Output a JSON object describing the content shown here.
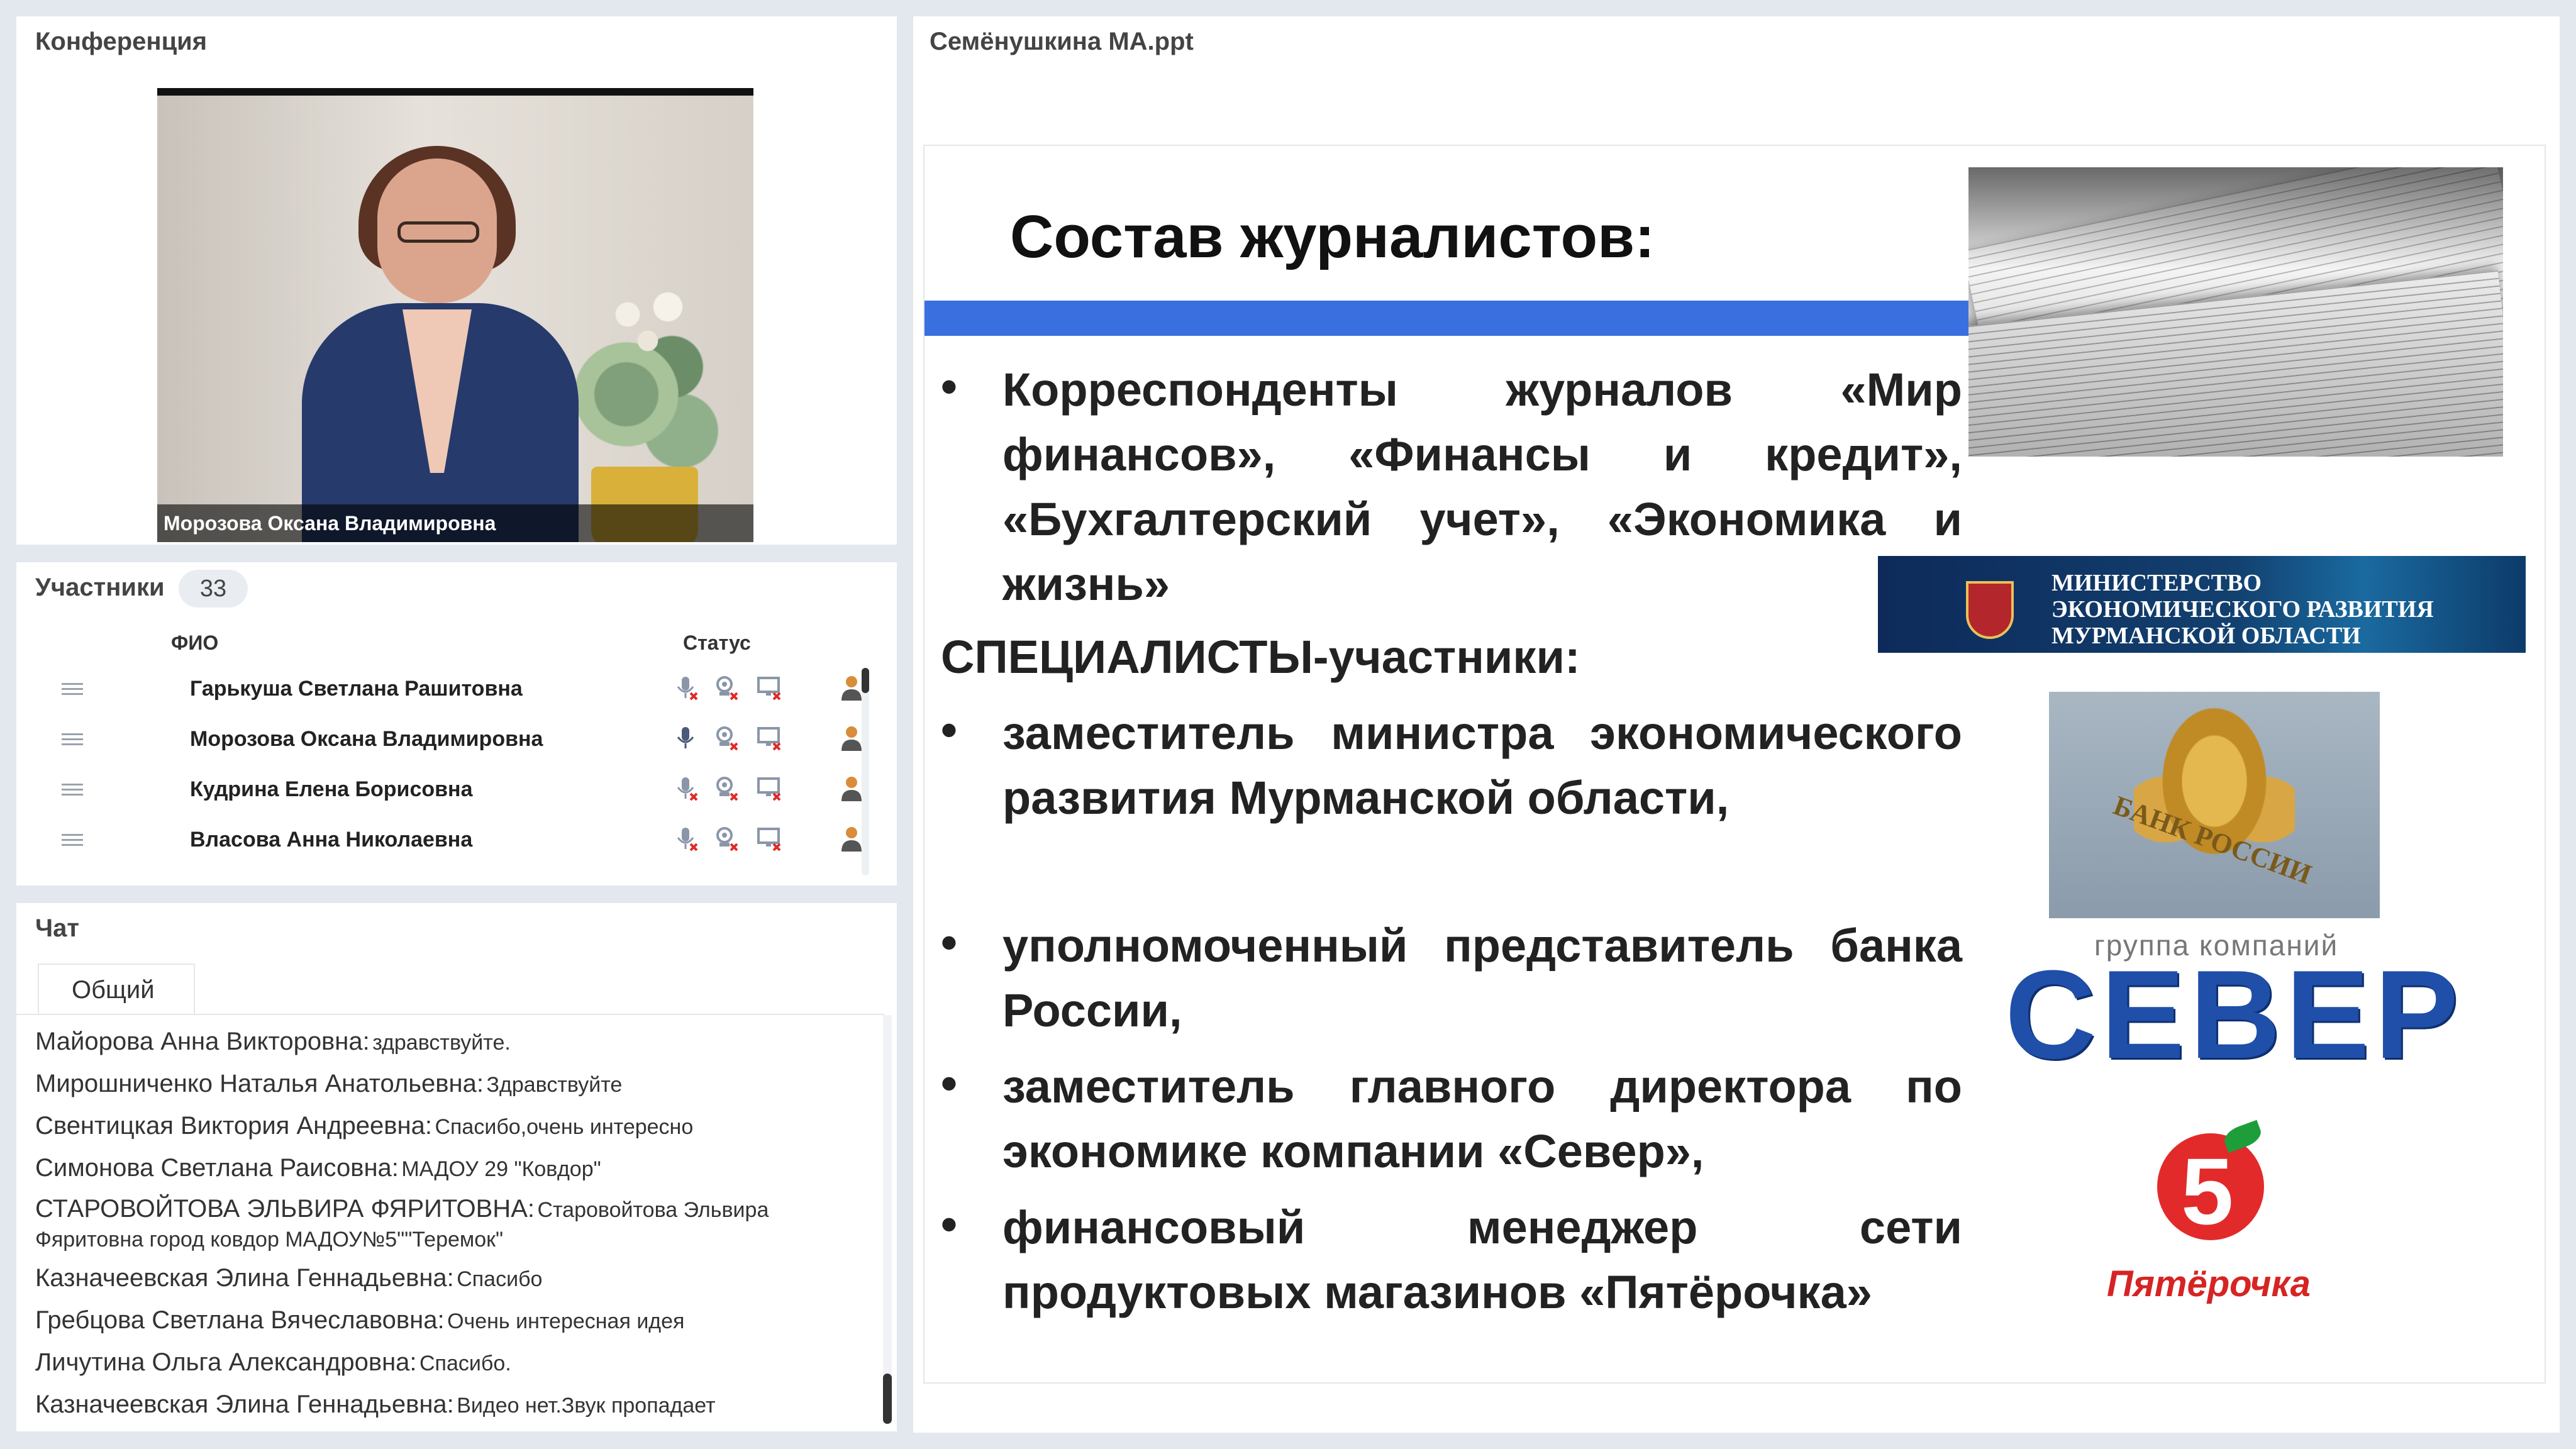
{
  "conference": {
    "title": "Конференция",
    "speaker_name": "Морозова Оксана Владимировна"
  },
  "participants": {
    "title": "Участники",
    "count": "33",
    "col_name": "ФИО",
    "col_status": "Статус",
    "rows": [
      {
        "name": "Гарькуша Светлана Рашитовна",
        "mic": "muted"
      },
      {
        "name": "Морозова Оксана Владимировна",
        "mic": "active"
      },
      {
        "name": "Кудрина Елена Борисовна",
        "mic": "muted"
      },
      {
        "name": "Власова Анна Николаевна",
        "mic": "muted"
      }
    ]
  },
  "chat": {
    "title": "Чат",
    "tab": "Общий",
    "messages": [
      {
        "author": "Майорова Анна Викторовна:",
        "text": "здравствуйте."
      },
      {
        "author": "Мирошниченко Наталья Анатольевна:",
        "text": "Здравствуйте"
      },
      {
        "author": "Свентицкая Виктория Андреевна:",
        "text": "Спасибо,очень интересно"
      },
      {
        "author": "Симонова  Светлана Раисовна:",
        "text": "МАДОУ 29 \"Ковдор\""
      },
      {
        "author": "СТАРОВОЙТОВА ЭЛЬВИРА ФЯРИТОВНА:",
        "text": "Старовойтова Эльвира Фяритовна город ковдор МАДОУ№5\"\"Теремок\""
      },
      {
        "author": "Казначеевская Элина Геннадьевна:",
        "text": "Спасибо"
      },
      {
        "author": "Гребцова Светлана Вячеславовна:",
        "text": "Очень интересная идея"
      },
      {
        "author": "Личутина  Ольга Александровна:",
        "text": "Спасибо."
      },
      {
        "author": "Казначеевская Элина Геннадьевна:",
        "text": "Видео нет.Звук  пропадает"
      }
    ]
  },
  "presentation": {
    "file_title": "Семёнушкина МА.ppt",
    "slide": {
      "title": "Состав журналистов:",
      "bullet1": "Корреспонденты журналов «Мир финансов», «Финансы и кредит», «Бухгалтерский учет», «Экономика и жизнь»",
      "section": "СПЕЦИАЛИСТЫ-участники:",
      "bullet2": "заместитель министра экономического развития Мурманской области,",
      "bullet3": "уполномоченный представитель банка России,",
      "bullet4": "заместитель главного директора по экономике компании «Север»,",
      "bullet5": "финансовый менеджер сети продуктовых магазинов «Пятёрочка»",
      "ministry_text": "МИНИСТЕРСТВО ЭКОНОМИЧЕСКОГО РАЗВИТИЯ МУРМАНСКОЙ ОБЛАСТИ",
      "bank_text": "БАНК РОССИИ",
      "sever_sub": "группа компаний",
      "sever_logo": "СЕВЕР",
      "pyat_five": "5",
      "pyat_text": "Пятёрочка"
    }
  },
  "colors": {
    "slide_bar": "#3a6fe0",
    "sever_blue": "#1f4fa8",
    "pyat_red": "#d62424"
  }
}
